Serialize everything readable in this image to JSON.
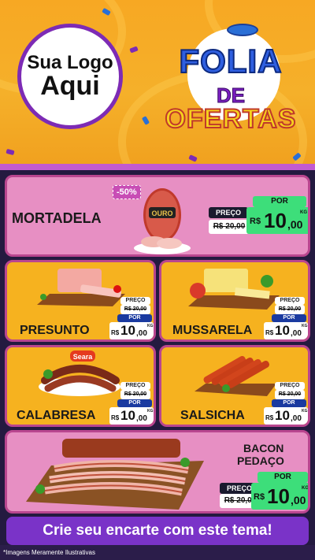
{
  "header": {
    "logo_line1": "Sua Logo",
    "logo_line2": "Aqui",
    "folia": "FOLIA",
    "de": "DE",
    "ofertas": "OFERTAS"
  },
  "products": [
    {
      "name": "MORTADELA",
      "discount": "-50%",
      "old_label": "PREÇO",
      "old_price": "R$ 20,00",
      "por": "POR",
      "currency": "R$",
      "price_int": "10",
      "price_dec": ",00",
      "unit": "KG",
      "brand": "OURO"
    },
    {
      "name": "PRESUNTO",
      "old_label": "PREÇO",
      "old_price": "R$ 20,00",
      "por": "POR",
      "currency": "R$",
      "price_int": "10",
      "price_dec": ",00",
      "unit": "KG"
    },
    {
      "name": "MUSSARELA",
      "old_label": "PREÇO",
      "old_price": "R$ 20,00",
      "por": "POR",
      "currency": "R$",
      "price_int": "10",
      "price_dec": ",00",
      "unit": "KG"
    },
    {
      "name": "CALABRESA",
      "old_label": "PREÇO",
      "old_price": "R$ 20,00",
      "por": "POR",
      "currency": "R$",
      "price_int": "10",
      "price_dec": ",00",
      "unit": "KG",
      "brand": "Seara"
    },
    {
      "name": "SALSICHA",
      "old_label": "PREÇO",
      "old_price": "R$ 20,00",
      "por": "POR",
      "currency": "R$",
      "price_int": "10",
      "price_dec": ",00",
      "unit": "KG"
    },
    {
      "name_line1": "BACON",
      "name_line2": "PEDAÇO",
      "old_label": "PREÇO",
      "old_price": "R$ 20,00",
      "por": "POR",
      "currency": "R$",
      "price_int": "10",
      "price_dec": ",00",
      "unit": "KG"
    }
  ],
  "footer": {
    "banner": "Crie seu encarte com este tema!",
    "disclaimer": "*Imagens Meramente Ilustrativas"
  },
  "colors": {
    "header": "#f5b02a",
    "pink_card": "#e78fc3",
    "yellow_card": "#f6b21f",
    "green_price": "#3dde7a",
    "banner": "#7a33c8"
  }
}
